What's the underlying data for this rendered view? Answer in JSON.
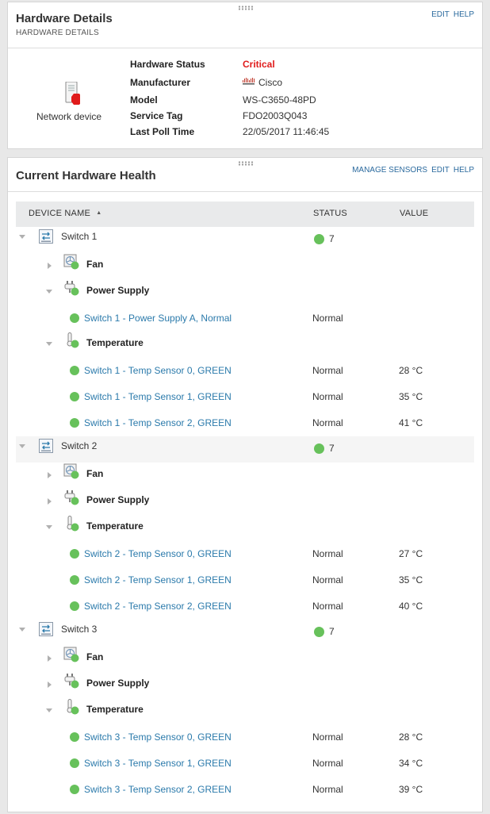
{
  "hardware_details": {
    "title": "Hardware Details",
    "subtitle": "HARDWARE DETAILS",
    "links": {
      "edit": "EDIT",
      "help": "HELP"
    },
    "device_label": "Network device",
    "fields": [
      {
        "key": "Hardware Status",
        "value": "Critical"
      },
      {
        "key": "Manufacturer",
        "value": "Cisco"
      },
      {
        "key": "Model",
        "value": "WS-C3650-48PD"
      },
      {
        "key": "Service Tag",
        "value": "FDO2003Q043"
      },
      {
        "key": "Last Poll Time",
        "value": "22/05/2017 11:46:45"
      }
    ],
    "status_color": "#e01b1b"
  },
  "health": {
    "title": "Current Hardware Health",
    "links": {
      "manage": "MANAGE SENSORS",
      "edit": "EDIT",
      "help": "HELP"
    },
    "columns": {
      "name": "DEVICE NAME",
      "sort_indicator": "▲",
      "status": "STATUS",
      "value": "VALUE"
    },
    "ok_color": "#67c15b",
    "switches": [
      {
        "name": "Switch 1",
        "count": "7",
        "categories": [
          {
            "name": "Fan",
            "expanded": false,
            "sensors": []
          },
          {
            "name": "Power Supply",
            "expanded": true,
            "sensors": [
              {
                "name": "Switch 1 - Power Supply A, Normal",
                "status": "Normal",
                "value": ""
              }
            ]
          },
          {
            "name": "Temperature",
            "expanded": true,
            "sensors": [
              {
                "name": "Switch 1 - Temp Sensor 0, GREEN",
                "status": "Normal",
                "value": "28 °C"
              },
              {
                "name": "Switch 1 - Temp Sensor 1, GREEN",
                "status": "Normal",
                "value": "35 °C"
              },
              {
                "name": "Switch 1 - Temp Sensor 2, GREEN",
                "status": "Normal",
                "value": "41 °C"
              }
            ]
          }
        ]
      },
      {
        "name": "Switch 2",
        "count": "7",
        "categories": [
          {
            "name": "Fan",
            "expanded": false,
            "sensors": []
          },
          {
            "name": "Power Supply",
            "expanded": false,
            "sensors": []
          },
          {
            "name": "Temperature",
            "expanded": true,
            "sensors": [
              {
                "name": "Switch 2 - Temp Sensor 0, GREEN",
                "status": "Normal",
                "value": "27 °C"
              },
              {
                "name": "Switch 2 - Temp Sensor 1, GREEN",
                "status": "Normal",
                "value": "35 °C"
              },
              {
                "name": "Switch 2 - Temp Sensor 2, GREEN",
                "status": "Normal",
                "value": "40 °C"
              }
            ]
          }
        ]
      },
      {
        "name": "Switch 3",
        "count": "7",
        "categories": [
          {
            "name": "Fan",
            "expanded": false,
            "sensors": []
          },
          {
            "name": "Power Supply",
            "expanded": false,
            "sensors": []
          },
          {
            "name": "Temperature",
            "expanded": true,
            "sensors": [
              {
                "name": "Switch 3 - Temp Sensor 0, GREEN",
                "status": "Normal",
                "value": "28 °C"
              },
              {
                "name": "Switch 3 - Temp Sensor 1, GREEN",
                "status": "Normal",
                "value": "34 °C"
              },
              {
                "name": "Switch 3 - Temp Sensor 2, GREEN",
                "status": "Normal",
                "value": "39 °C"
              }
            ]
          }
        ]
      }
    ]
  }
}
